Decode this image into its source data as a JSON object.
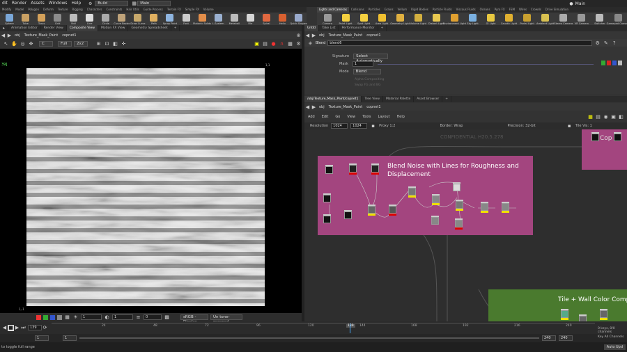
{
  "menu": {
    "items": [
      "dit",
      "Render",
      "Assets",
      "Windows",
      "Help"
    ],
    "build": "Build",
    "desktop": "Main",
    "main": "Main"
  },
  "shelf_left": {
    "tabs": [
      "Modify",
      "Model",
      "Polygon",
      "Deform",
      "Texture",
      "Rigging",
      "Characters",
      "Constraints",
      "Hair Utils",
      "Guide Process",
      "Terrain FX",
      "Simple FX",
      "Volume"
    ],
    "tools": [
      "Sphere",
      "Tube",
      "Torus",
      "Grid",
      "Null",
      "Line",
      "Circle",
      "Curve Bezier",
      "Draw Curve",
      "Path",
      "Spray Paint",
      "Font",
      "Platonic Solids",
      "L-System",
      "Metaball",
      "File",
      "Spiral",
      "Helix",
      "Quick Shapes"
    ]
  },
  "shelf_right": {
    "tabs": [
      "Lights and Cameras",
      "Collisions",
      "Particles",
      "Grains",
      "Vellum",
      "Rigid Bodies",
      "Particle Fluids",
      "Viscous Fluids",
      "Oceans",
      "Pyro FX",
      "FEM",
      "Wires",
      "Crowds",
      "Drive Simulation"
    ],
    "tools": [
      "Camera",
      "Point Light",
      "Spot Light",
      "Area Light",
      "Geometry Light",
      "Volume Light",
      "Distant Light",
      "Environment Light",
      "Sky Light",
      "GI Light",
      "Caustic Light",
      "Portal Light",
      "Ambient Light",
      "Stereo Camera",
      "VR Camera",
      "Switcher",
      "Gamepad Camera"
    ]
  },
  "left_pane": {
    "tabs": [
      "Animation Editor",
      "Render View",
      "Composite View",
      "Motion FX View",
      "Geometry Spreadsheet"
    ],
    "path": [
      "obj",
      "Texture_Mask_Paint",
      "copnet1"
    ],
    "toolbar": {
      "plane": "C",
      "res": "Full",
      "zoom": "2x2"
    },
    "frame_label": "39]",
    "corner_tl": "1,1",
    "corner_bl": "1,-1",
    "bottom": {
      "f1": "1",
      "f2": "1",
      "f3": "0",
      "space": "sRGB - Display",
      "tonemap": "Un tone-mapped"
    }
  },
  "params": {
    "tabs": [
      "Untitl",
      "Take List",
      "Performance Monitor"
    ],
    "path": [
      "obj",
      "Texture_Mask_Paint",
      "copnet1"
    ],
    "node_type": "Blend",
    "node_name": "blend6",
    "signature_label": "Signature",
    "signature_value": "Select Automatically",
    "mask_label": "Mask",
    "mask_value": "1",
    "mode_label": "Mode",
    "mode_value": "Blend",
    "alpha": "Alpha Compositing",
    "swap": "Swap FG and BG"
  },
  "network": {
    "tabs": [
      "/obj/Texture_Mask_Paint/copnet1",
      "Tree View",
      "Material Palette",
      "Asset Browser"
    ],
    "path": [
      "obj",
      "Texture_Mask_Paint",
      "copnet1"
    ],
    "menu": [
      "Add",
      "Edit",
      "Go",
      "View",
      "Tools",
      "Layout",
      "Help"
    ],
    "res_label": "Resolution",
    "res_w": "1024",
    "res_h": "1024",
    "proxy": "Proxy 1:2",
    "border": "Border: Wrap",
    "precision": "Precision: 32-bit",
    "tile": "Tile Vis: 1",
    "watermark": "CONFIDENTIAL H20.5.278",
    "box_pink_title": "Blend Noise with Lines for Roughness and Displacement",
    "box_green_title": "Tile + Wall Color Comp",
    "box_top_title": "Cop"
  },
  "timeline": {
    "frame": "139",
    "ticks": [
      "24",
      "48",
      "72",
      "96",
      "120",
      "139",
      "144",
      "168",
      "192",
      "216",
      "240"
    ],
    "start": "1",
    "start2": "1",
    "end": "240",
    "end2": "240",
    "keys": "0 keys, 0/0 channels",
    "keyall": "Key All Channels",
    "auto": "Auto Upd",
    "status": "to toggle full range"
  }
}
